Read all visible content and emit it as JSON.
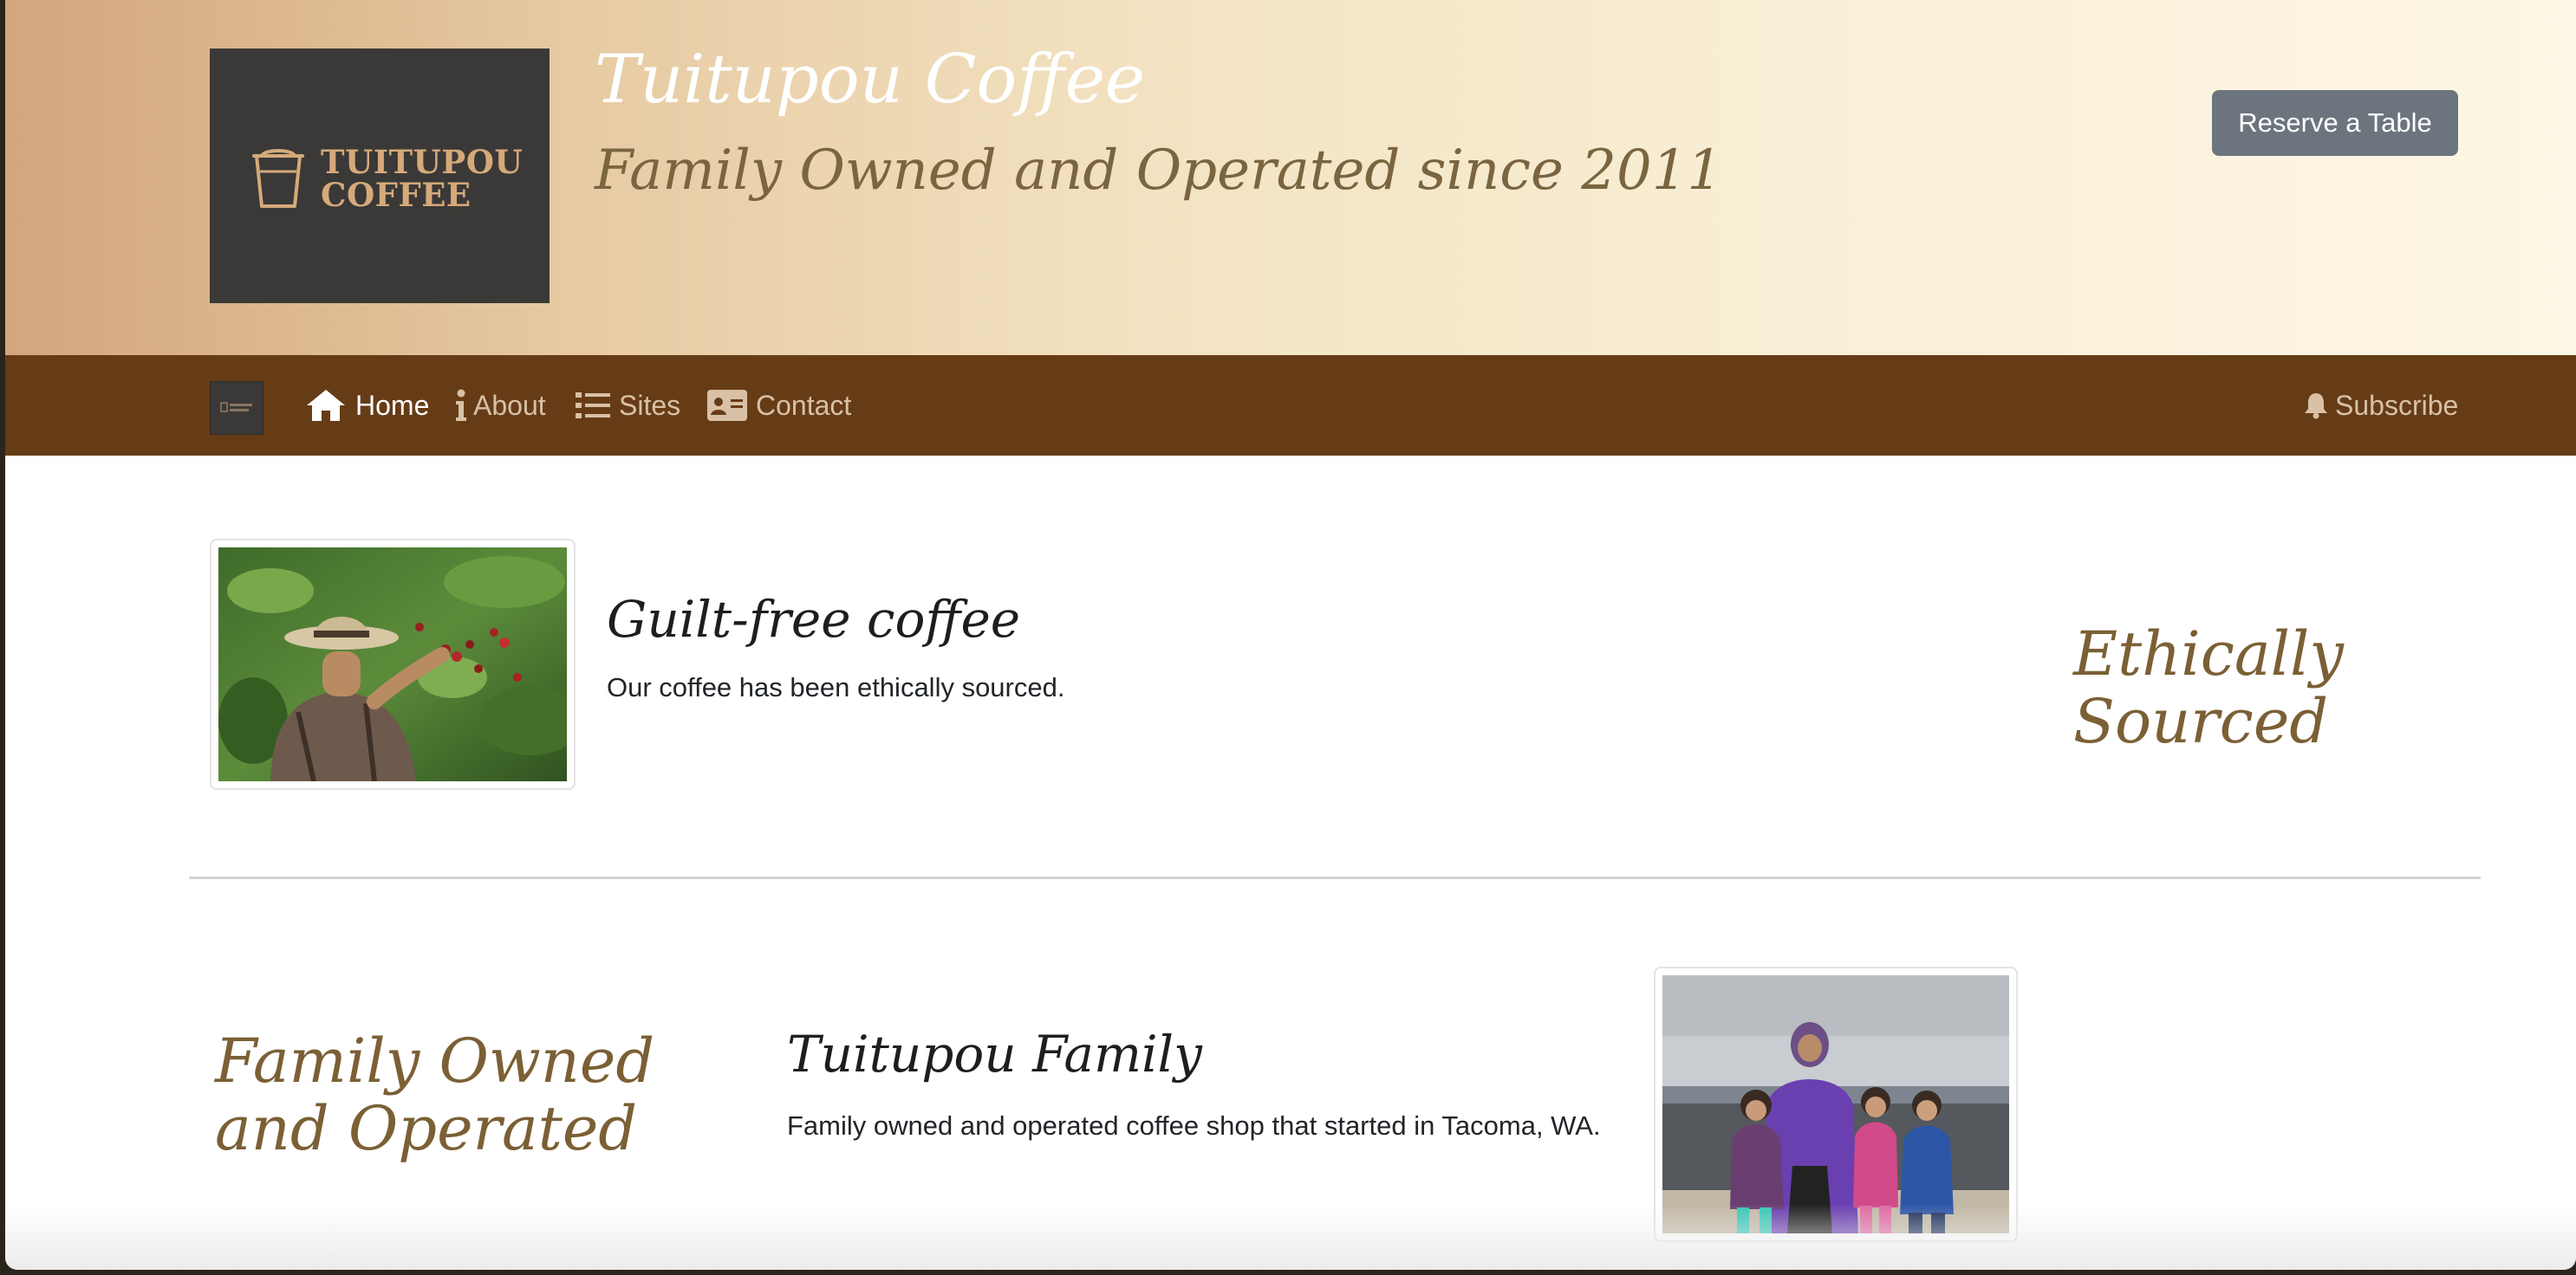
{
  "header": {
    "logo_line1": "TUITUPOU",
    "logo_line2": "COFFEE",
    "title": "Tuitupou Coffee",
    "tagline": "Family Owned and Operated since 2011",
    "reserve_label": "Reserve a Table"
  },
  "nav": {
    "items": [
      {
        "label": "Home",
        "icon": "home-icon",
        "active": true
      },
      {
        "label": "About",
        "icon": "info-icon",
        "active": false
      },
      {
        "label": "Sites",
        "icon": "list-icon",
        "active": false
      },
      {
        "label": "Contact",
        "icon": "contact-card-icon",
        "active": false
      }
    ],
    "subscribe_label": "Subscribe"
  },
  "sections": {
    "ethics": {
      "title": "Guilt-free coffee",
      "text": "Our coffee has been ethically sourced.",
      "side_heading": "Ethically Sourced"
    },
    "family": {
      "side_heading": "Family Owned and Operated",
      "title": "Tuitupou Family",
      "text": "Family owned and operated coffee shop that started in Tacoma, WA."
    }
  },
  "colors": {
    "navbar": "#663c17",
    "accent_script": "#7b6035",
    "button": "#6c757d",
    "logo_bg": "#3a3937"
  }
}
